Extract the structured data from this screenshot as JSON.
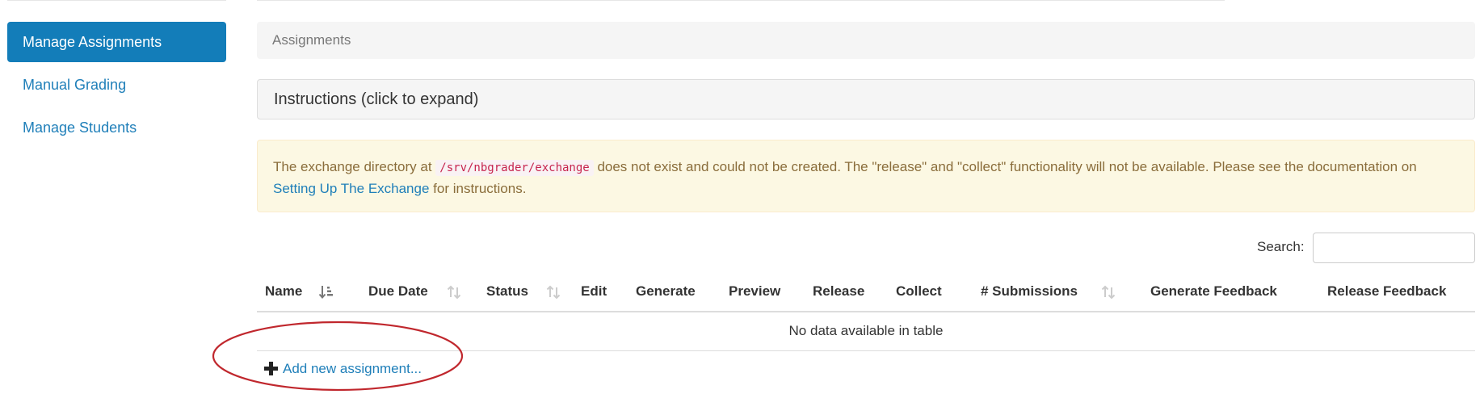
{
  "sidebar": {
    "items": [
      {
        "label": "Manage Assignments"
      },
      {
        "label": "Manual Grading"
      },
      {
        "label": "Manage Students"
      }
    ]
  },
  "breadcrumb": {
    "current": "Assignments"
  },
  "instructions": {
    "label": "Instructions (click to expand)"
  },
  "alert": {
    "text_before": "The exchange directory at ",
    "path": "/srv/nbgrader/exchange",
    "text_middle": " does not exist and could not be created. The \"release\" and \"collect\" functionality will not be available. Please see the documentation on ",
    "link": "Setting Up The Exchange",
    "text_after": " for instructions."
  },
  "search": {
    "label": "Search:",
    "value": ""
  },
  "table": {
    "columns": [
      {
        "label": "Name",
        "sortable": true,
        "sort": "ascending"
      },
      {
        "label": "Due Date",
        "sortable": true
      },
      {
        "label": "Status",
        "sortable": true
      },
      {
        "label": "Edit"
      },
      {
        "label": "Generate"
      },
      {
        "label": "Preview"
      },
      {
        "label": "Release"
      },
      {
        "label": "Collect"
      },
      {
        "label": "# Submissions",
        "sortable": true
      },
      {
        "label": "Generate Feedback"
      },
      {
        "label": "Release Feedback"
      }
    ],
    "empty_message": "No data available in table"
  },
  "add_assignment": {
    "label": "Add new assignment...",
    "icon": "plus-icon"
  },
  "colors": {
    "accent": "#137db9",
    "link": "#1f7fb9",
    "warning_bg": "#fcf8e3",
    "warning_text": "#8a6d3b",
    "annotation": "#c0272d"
  }
}
